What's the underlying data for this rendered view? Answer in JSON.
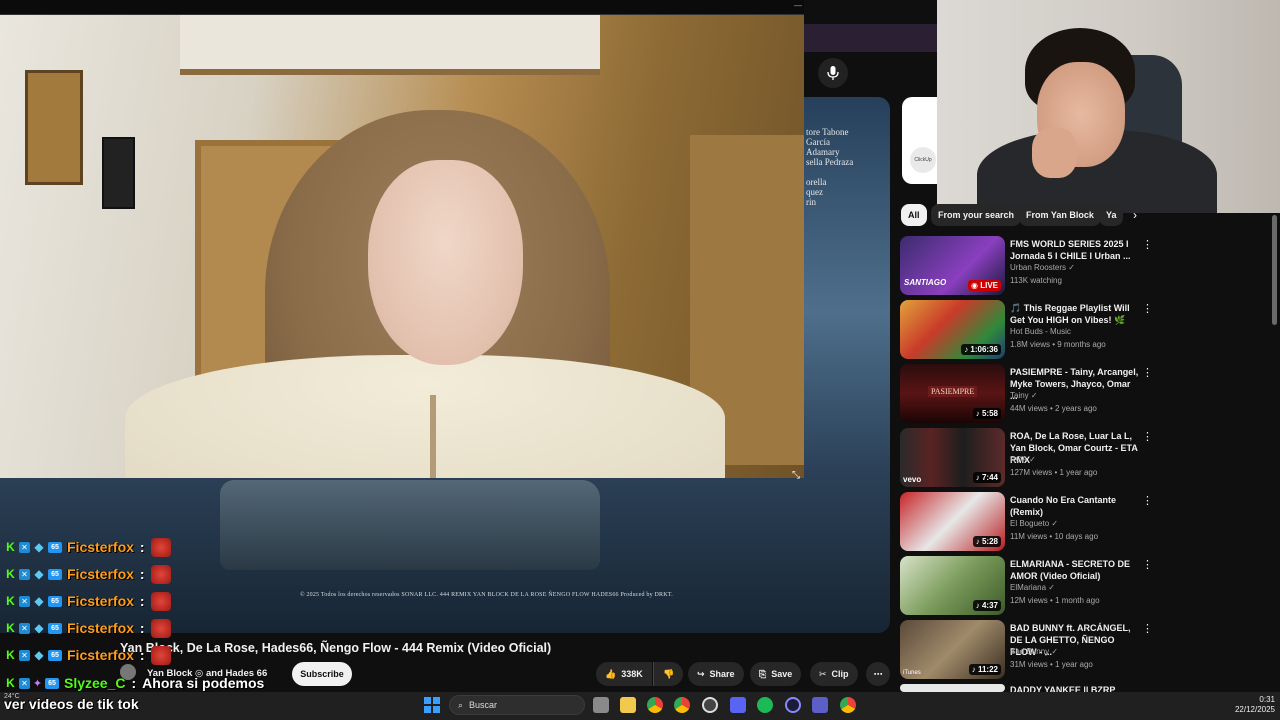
{
  "youtube": {
    "video_title": "Yan Block, De La Rose, Hades66, Ñengo Flow - 444 Remix (Video Oficial)",
    "channel_name": "Yan Block ◎ and Hades 66",
    "subscribe_label": "Subscribe",
    "like_count": "338K",
    "share_label": "Share",
    "save_label": "Save",
    "clip_label": "Clip",
    "video_credits": "© 2025 Todos los derechos reservados SONAR LLC.      444 REMIX      YAN BLOCK      DE LA ROSE      ÑENGO FLOW      HADES66          Produced by DRKT.",
    "credit_names": [
      "tore Tabone",
      "García",
      "Adamary",
      "sella Pedraza",
      "",
      "orella",
      "quez",
      "rin"
    ],
    "ad_badge": "ClickUp",
    "chips": [
      "All",
      "From your search",
      "From Yan Block",
      "Ya"
    ],
    "recommendations": [
      {
        "title": "FMS WORLD SERIES 2025 I Jornada 5 I CHILE I Urban ...",
        "channel": "Urban Roosters",
        "meta": "113K watching",
        "duration": "LIVE",
        "thumb_text": "SANTIAGO"
      },
      {
        "title": "🎵 This Reggae Playlist Will Get You HIGH on Vibes! 🌿",
        "channel": "Hot Buds - Music",
        "meta": "1.8M views • 9 months ago",
        "duration": "1:06:36",
        "thumb_text": ""
      },
      {
        "title": "PASIEMPRE - Tainy, Arcangel, Myke Towers, Jhayco, Omar ...",
        "channel": "Tainy",
        "meta": "44M views • 2 years ago",
        "duration": "5:58",
        "thumb_text": "PASIEMPRE"
      },
      {
        "title": "ROA, De La Rose, Luar La L, Yan Block, Omar Courtz - ETA RMX",
        "channel": "ROA",
        "meta": "127M views • 1 year ago",
        "duration": "7:44",
        "thumb_text": "vevo"
      },
      {
        "title": "Cuando No Era Cantante (Remix)",
        "channel": "El Bogueto",
        "meta": "11M views • 10 days ago",
        "duration": "5:28",
        "thumb_text": ""
      },
      {
        "title": "ELMARIANA - SECRETO DE AMOR (Video Oficial)",
        "channel": "ElMariana",
        "meta": "12M views • 1 month ago",
        "duration": "4:37",
        "thumb_text": ""
      },
      {
        "title": "BAD BUNNY ft. ARCÁNGEL, DE LA GHETTO, ÑENGO FLOW - ...",
        "channel": "Bad Bunny",
        "meta": "31M views • 1 year ago",
        "duration": "11:22",
        "thumb_text": "iTunes"
      },
      {
        "title": "DADDY YANKEE || BZRP Music",
        "channel": "",
        "meta": "",
        "duration": "",
        "thumb_text": ""
      }
    ]
  },
  "chat": {
    "username_1": "Ficsterfox",
    "username_2": "Slyzee_C",
    "colon": ":",
    "message_1": "Ahora si podemos",
    "message_2": "ver videos de tik tok",
    "badges": {
      "k": "K",
      "x": "✕",
      "cube": "◆",
      "num": "65"
    }
  },
  "taskbar": {
    "search_placeholder": "Buscar",
    "weather": "24°C",
    "time": "0:31",
    "date": "22/12/2025",
    "apps": [
      "file-explorer",
      "folder",
      "chrome",
      "chrome-2",
      "obs",
      "discord",
      "spotify",
      "app",
      "teams",
      "chrome-3"
    ]
  },
  "colors": {
    "chat_name": "#ff9d1c",
    "chat_name_2": "#53fc18",
    "youtube_bg": "#0f0f0f"
  }
}
